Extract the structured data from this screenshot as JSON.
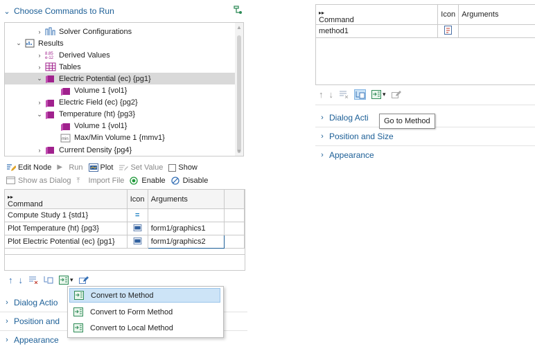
{
  "left": {
    "section_title": "Choose Commands to Run",
    "tree": [
      {
        "label": "Solver Configurations",
        "indent": 1,
        "expander": "›",
        "icon": "solver-config-icon"
      },
      {
        "label": "Results",
        "indent": 0,
        "expander": "⌄",
        "icon": "results-icon"
      },
      {
        "label": "Derived Values",
        "indent": 1,
        "expander": "›",
        "icon": "derived-values-icon"
      },
      {
        "label": "Tables",
        "indent": 1,
        "expander": "›",
        "icon": "table-icon"
      },
      {
        "label": "Electric Potential (ec) {pg1}",
        "indent": 1,
        "expander": "⌄",
        "icon": "plot-group-icon",
        "selected": true
      },
      {
        "label": "Volume 1 {vol1}",
        "indent": 2,
        "expander": "",
        "icon": "volume-icon"
      },
      {
        "label": "Electric Field (ec) {pg2}",
        "indent": 1,
        "expander": "›",
        "icon": "plot-group-icon"
      },
      {
        "label": "Temperature (ht) {pg3}",
        "indent": 1,
        "expander": "⌄",
        "icon": "plot-group-icon"
      },
      {
        "label": "Volume 1 {vol1}",
        "indent": 2,
        "expander": "",
        "icon": "volume-icon"
      },
      {
        "label": "Max/Min Volume 1 {mmv1}",
        "indent": 2,
        "expander": "",
        "icon": "maxmin-icon"
      },
      {
        "label": "Current Density {pg4}",
        "indent": 1,
        "expander": "›",
        "icon": "plot-group-icon"
      }
    ],
    "toolbar1": {
      "edit_node": "Edit Node",
      "run": "Run",
      "plot": "Plot",
      "set_value": "Set Value",
      "show": "Show"
    },
    "toolbar2": {
      "show_as_dialog": "Show as Dialog",
      "import_file": "Import File",
      "enable": "Enable",
      "disable": "Disable"
    },
    "table": {
      "headers": [
        "Command",
        "Icon",
        "Arguments"
      ],
      "rows": [
        {
          "command": "Compute Study 1 {std1}",
          "icon": "compute-icon",
          "arguments": ""
        },
        {
          "command": "Plot Temperature (ht) {pg3}",
          "icon": "plot-icon",
          "arguments": "form1/graphics1"
        },
        {
          "command": "Plot Electric Potential (ec) {pg1}",
          "icon": "plot-icon",
          "arguments": "form1/graphics2"
        }
      ]
    },
    "sections": [
      "Dialog Actio",
      "Position and",
      "Appearance"
    ],
    "context_menu": [
      "Convert to Method",
      "Convert to Form Method",
      "Convert to Local Method"
    ]
  },
  "right": {
    "table": {
      "headers": [
        "Command",
        "Icon",
        "Arguments"
      ],
      "rows": [
        {
          "command": "method1",
          "icon": "method-icon",
          "arguments": ""
        }
      ]
    },
    "sections": [
      "Dialog Acti",
      "Position and Size",
      "Appearance"
    ],
    "tooltip": "Go to Method"
  },
  "colors": {
    "accent": "#1b5e96",
    "plot_group": "#a0218d",
    "selection": "#d9d9d9",
    "menu_highlight": "#cde4f7"
  }
}
